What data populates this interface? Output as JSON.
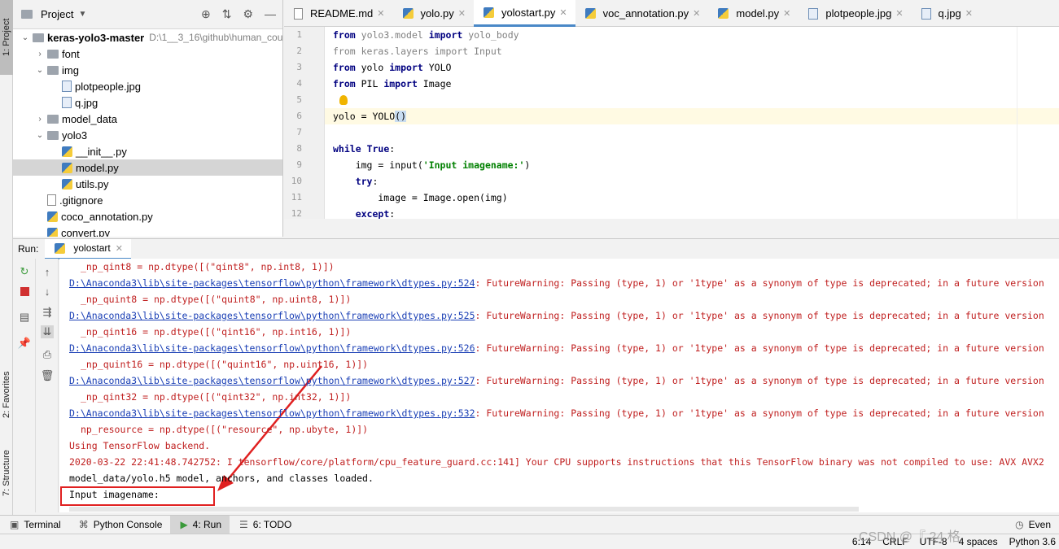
{
  "left_strip": {
    "project_tab": "1: Project",
    "favorites_tab": "2: Favorites",
    "structure_tab": "7: Structure"
  },
  "project": {
    "title": "Project",
    "tree": [
      {
        "label": "keras-yolo3-master",
        "path": "D:\\1__3_16\\github\\human_cou",
        "kind": "folder",
        "depth": 0,
        "expanded": true
      },
      {
        "label": "font",
        "kind": "folder",
        "depth": 1,
        "expanded": false
      },
      {
        "label": "img",
        "kind": "folder",
        "depth": 1,
        "expanded": true
      },
      {
        "label": "plotpeople.jpg",
        "kind": "image",
        "depth": 2
      },
      {
        "label": "q.jpg",
        "kind": "image",
        "depth": 2
      },
      {
        "label": "model_data",
        "kind": "folder",
        "depth": 1,
        "expanded": false
      },
      {
        "label": "yolo3",
        "kind": "folder",
        "depth": 1,
        "expanded": true
      },
      {
        "label": "__init__.py",
        "kind": "python",
        "depth": 2
      },
      {
        "label": "model.py",
        "kind": "python",
        "depth": 2,
        "selected": true
      },
      {
        "label": "utils.py",
        "kind": "python",
        "depth": 2
      },
      {
        "label": ".gitignore",
        "kind": "text",
        "depth": 1
      },
      {
        "label": "coco_annotation.py",
        "kind": "python",
        "depth": 1
      },
      {
        "label": "convert.py",
        "kind": "python",
        "depth": 1
      }
    ]
  },
  "editor": {
    "tabs": [
      {
        "label": "README.md",
        "icon": "markdown-icon",
        "active": false
      },
      {
        "label": "yolo.py",
        "icon": "python-icon",
        "active": false
      },
      {
        "label": "yolostart.py",
        "icon": "python-icon",
        "active": true
      },
      {
        "label": "voc_annotation.py",
        "icon": "python-icon",
        "active": false
      },
      {
        "label": "model.py",
        "icon": "python-icon",
        "active": false
      },
      {
        "label": "plotpeople.jpg",
        "icon": "image-icon",
        "active": false
      },
      {
        "label": "q.jpg",
        "icon": "image-icon",
        "active": false
      }
    ],
    "line_numbers": [
      "1",
      "2",
      "3",
      "4",
      "5",
      "6",
      "7",
      "8",
      "9",
      "10",
      "11",
      "12"
    ],
    "current_line": "6"
  },
  "run": {
    "label": "Run:",
    "config": "yolostart",
    "console": [
      "_np_qint8 = np.dtype([(\"qint8\", np.int8, 1)])",
      "D:\\Anaconda3\\lib\\site-packages\\tensorflow\\python\\framework\\dtypes.py:524",
      "_np_quint8 = np.dtype([(\"quint8\", np.uint8, 1)])",
      "D:\\Anaconda3\\lib\\site-packages\\tensorflow\\python\\framework\\dtypes.py:525",
      "_np_qint16 = np.dtype([(\"qint16\", np.int16, 1)])",
      "D:\\Anaconda3\\lib\\site-packages\\tensorflow\\python\\framework\\dtypes.py:526",
      "_np_quint16 = np.dtype([(\"quint16\", np.uint16, 1)])",
      "D:\\Anaconda3\\lib\\site-packages\\tensorflow\\python\\framework\\dtypes.py:527",
      "_np_qint32 = np.dtype([(\"qint32\", np.int32, 1)])",
      "D:\\Anaconda3\\lib\\site-packages\\tensorflow\\python\\framework\\dtypes.py:532",
      "np_resource = np.dtype([(\"resource\", np.ubyte, 1)])",
      "Using TensorFlow backend.",
      "2020-03-22 22:41:48.742752: I tensorflow/core/platform/cpu_feature_guard.cc:141] Your CPU supports instructions that this TensorFlow binary was not compiled to use: AVX AVX2",
      "model_data/yolo.h5 model, anchors, and classes loaded.",
      "Input imagename:"
    ],
    "warning_text": ": FutureWarning: Passing (type, 1) or '1type' as a synonym of type is deprecated; in a future version"
  },
  "bottom_tabs": [
    {
      "label": "Terminal",
      "icon": "terminal-icon"
    },
    {
      "label": "Python Console",
      "icon": "python-console-icon"
    },
    {
      "label": "4: Run",
      "icon": "run-icon",
      "active": true
    },
    {
      "label": "6: TODO",
      "icon": "todo-icon"
    },
    {
      "label": "Even",
      "icon": "event-log-icon"
    }
  ],
  "status": {
    "position": "6:14",
    "line_sep": "CRLF",
    "encoding": "UTF-8",
    "indent": "4 spaces",
    "interpreter": "Python 3.6"
  },
  "watermark": "CSDN @『 24 格",
  "colors": {
    "accent": "#4a88c7",
    "error": "#c02020",
    "link": "#1a3fb5",
    "highlight_box": "#e02020"
  }
}
